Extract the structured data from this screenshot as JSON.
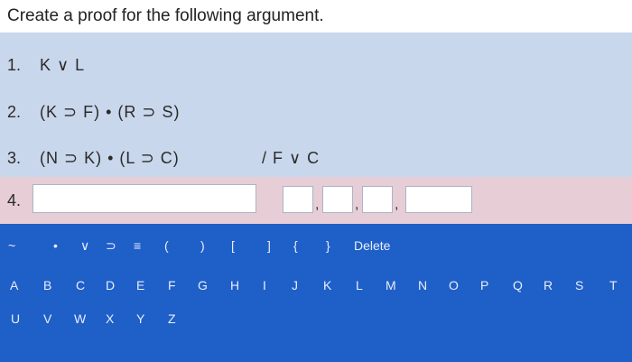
{
  "title": "Create a proof for the following argument.",
  "lines": [
    {
      "num": "1.",
      "formula": "K ∨ L"
    },
    {
      "num": "2.",
      "formula": "(K ⊃ F) • (R ⊃ S)"
    },
    {
      "num": "3.",
      "formula": "(N ⊃ K) • (L ⊃ C)"
    }
  ],
  "conclusion": "/ F ∨ C",
  "new_line": {
    "num": "4.",
    "statement_value": "",
    "comma": ","
  },
  "symbols": [
    "~",
    "•",
    "∨",
    "⊃",
    "≡",
    "(",
    ")",
    "[",
    "]",
    "{",
    "}",
    "Delete"
  ],
  "letters_row1": [
    "A",
    "B",
    "C",
    "D",
    "E",
    "F",
    "G",
    "H",
    "I",
    "J",
    "K",
    "L",
    "M",
    "N",
    "O",
    "P",
    "Q",
    "R",
    "S",
    "T"
  ],
  "letters_row2": [
    "U",
    "V",
    "W",
    "X",
    "Y",
    "Z"
  ]
}
